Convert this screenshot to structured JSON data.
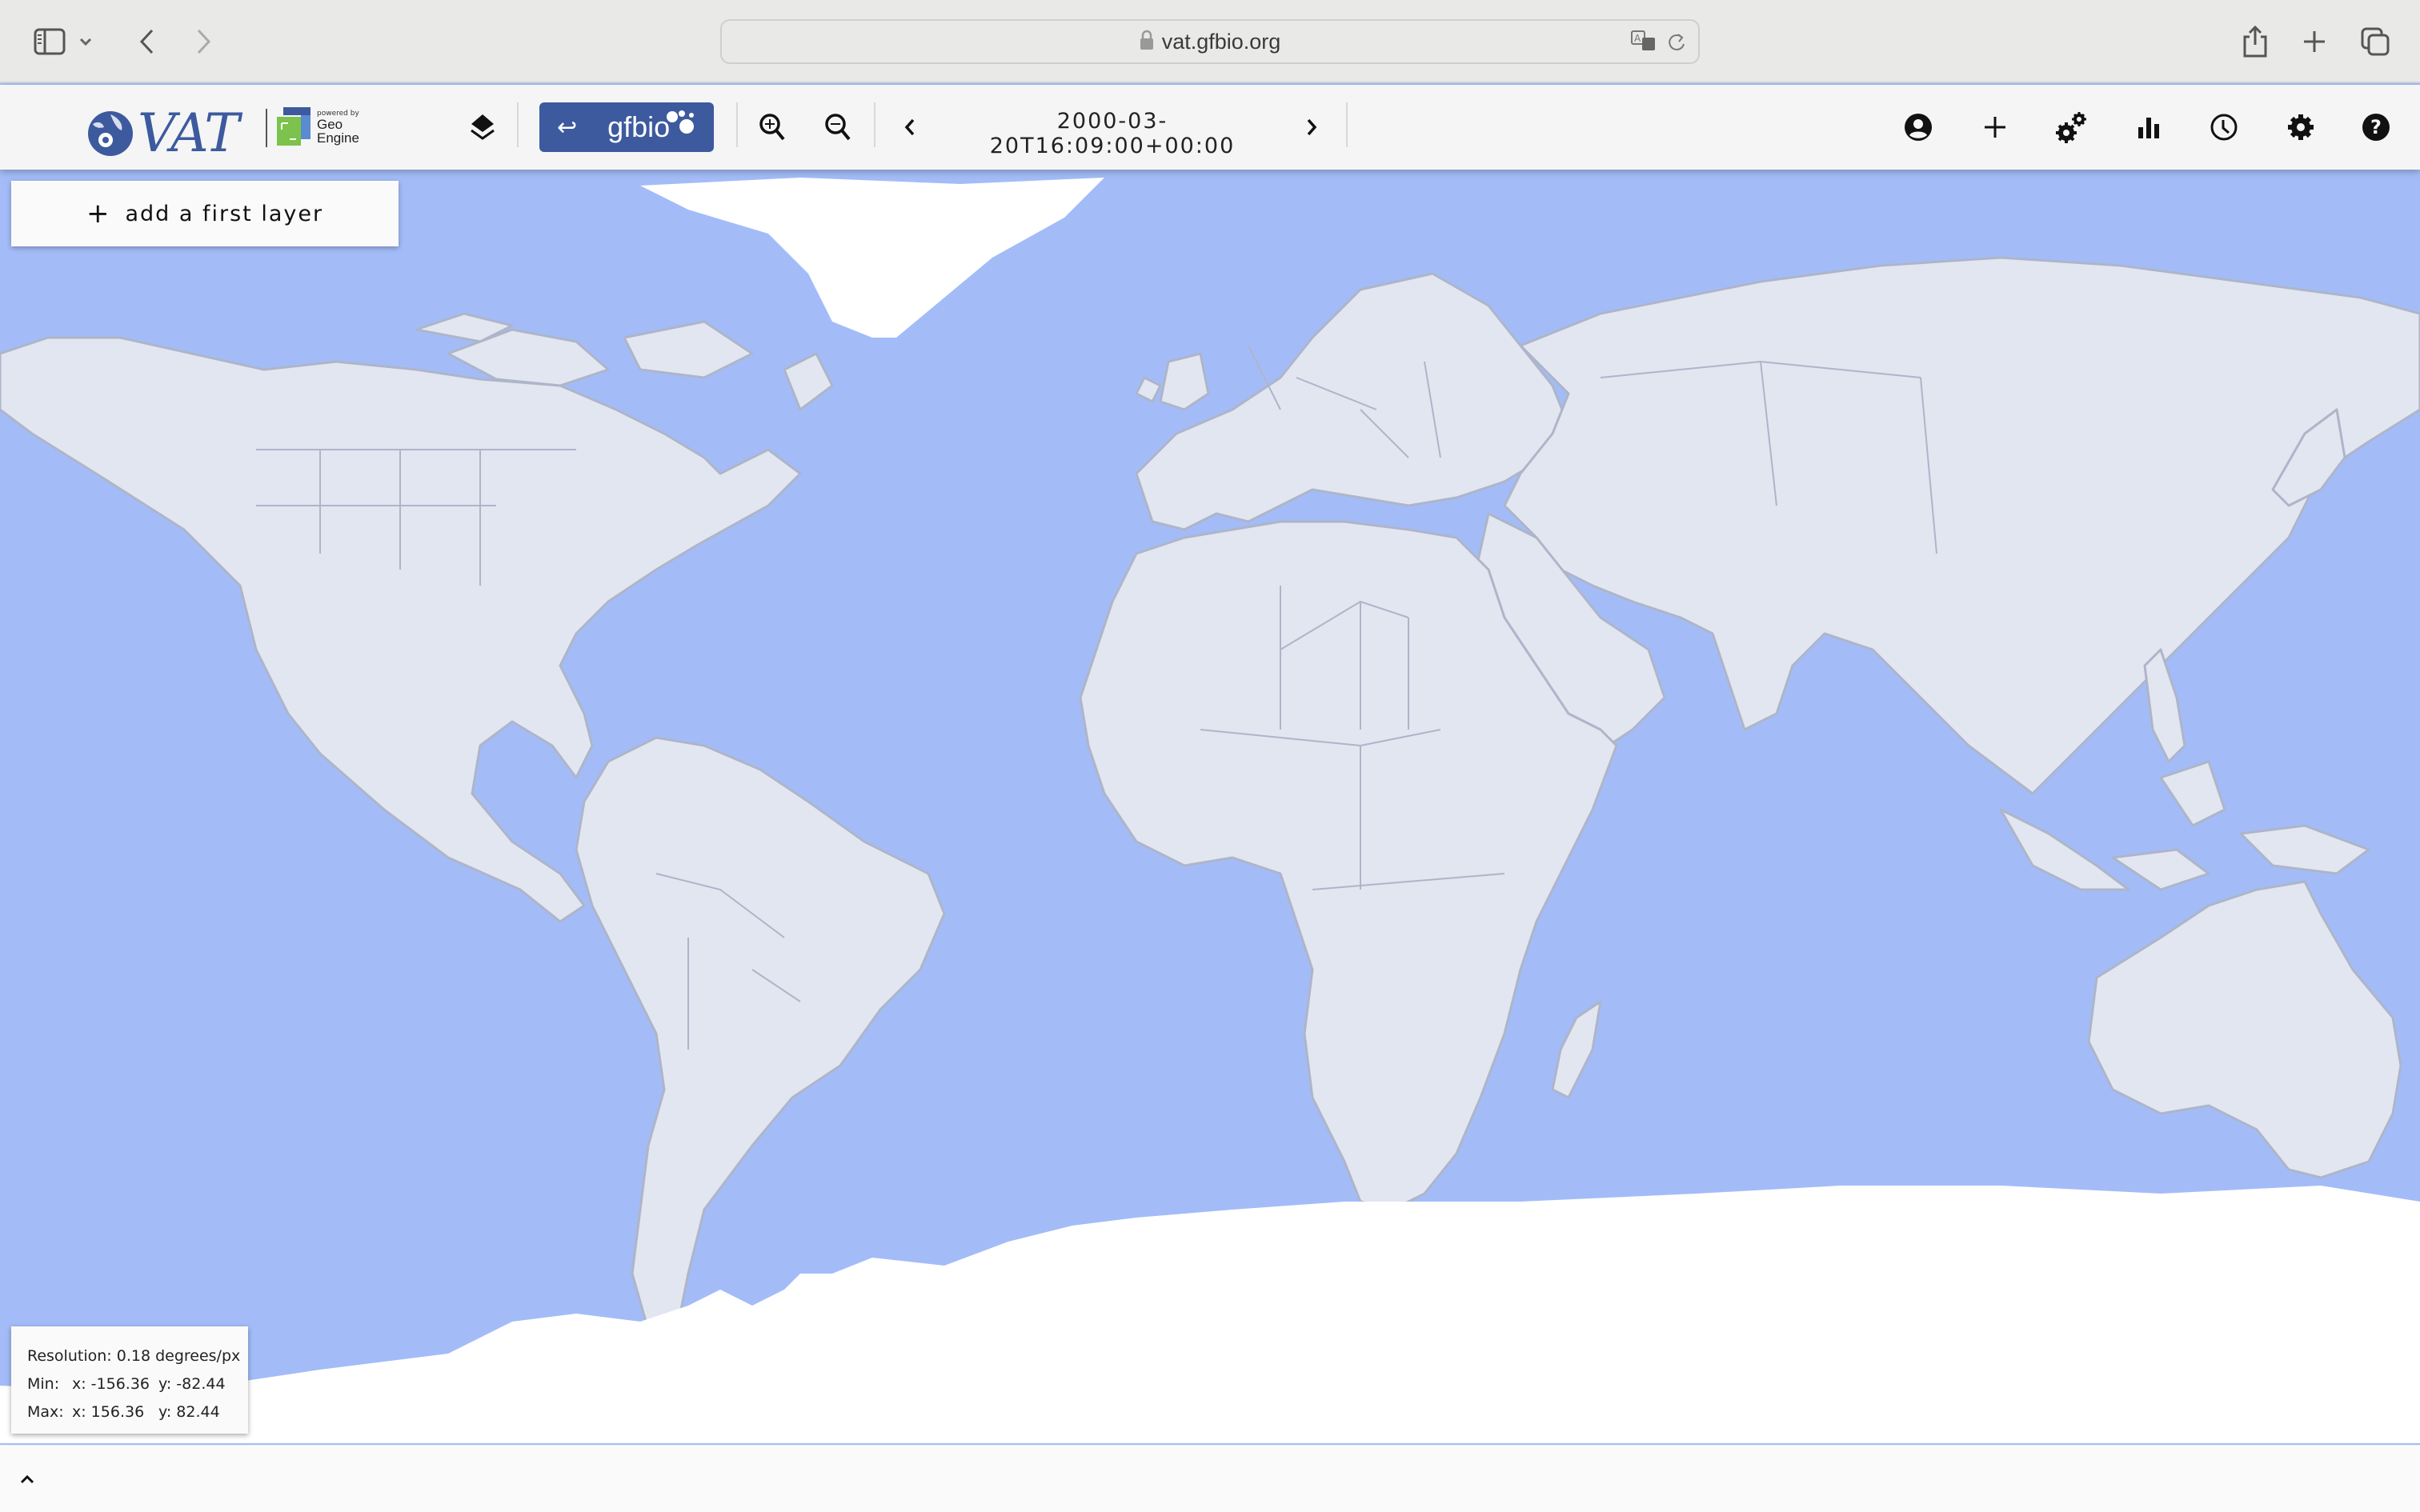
{
  "browser": {
    "url": "vat.gfbio.org",
    "icons": [
      "sidebar-icon",
      "chevron-down-icon",
      "back-icon",
      "forward-icon",
      "lock-icon",
      "translate-icon",
      "reload-icon",
      "share-icon",
      "new-tab-icon",
      "tabs-overview-icon"
    ]
  },
  "toolbar": {
    "logo_text": "VAT",
    "powered_by": "powered by",
    "geo_engine_line1": "Geo",
    "geo_engine_line2": "Engine",
    "gfbio_label": "gfbio",
    "gfbio_back_glyph": "↩",
    "time": "2000-03-20T16:09:00+00:00",
    "right_icons": [
      "account-icon",
      "add-data-icon",
      "operators-icon",
      "plots-icon",
      "time-icon",
      "settings-icon",
      "help-icon"
    ]
  },
  "layers": {
    "add_first_layer_label": "add a first layer",
    "plus_glyph": "+"
  },
  "info": {
    "resolution_label": "Resolution:",
    "resolution_value": "0.18 degrees/px",
    "min_label": "Min:",
    "min_x": "x: -156.36",
    "min_y": "y: -82.44",
    "max_label": "Max:",
    "max_x": "x: 156.36",
    "max_y": "y: 82.44"
  },
  "map": {
    "colors": {
      "ocean": "#a3bcf8",
      "land": "#e1e6f0",
      "border": "#aeb5c9",
      "ice": "#ffffff"
    }
  },
  "bottom": {
    "expand_glyph": "^"
  }
}
